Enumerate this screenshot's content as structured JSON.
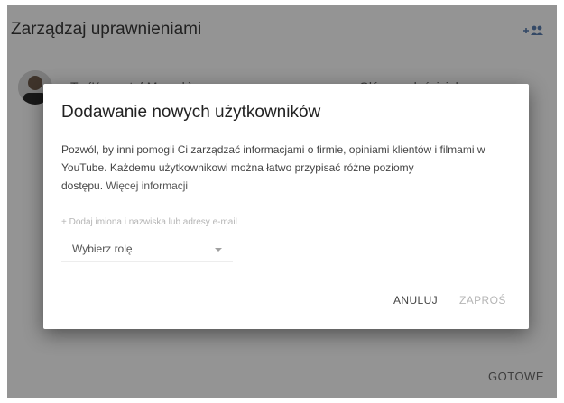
{
  "background": {
    "title": "Zarządzaj uprawnieniami",
    "add_people_icon": "add-people-icon",
    "user": {
      "name": "Ty (Krzysztof Mrozek)",
      "role": "Główny właściciel"
    },
    "done_label": "GOTOWE"
  },
  "dialog": {
    "title": "Dodawanie nowych użytkowników",
    "description_line1": "Pozwól, by inni pomogli Ci zarządzać informacjami o firmie, opiniami klientów i filmami w",
    "description_line2": "YouTube. Każdemu użytkownikowi można łatwo przypisać różne poziomy",
    "description_line3": "dostępu.",
    "learn_more": "Więcej informacji",
    "email_placeholder": "+ Dodaj imiona i nazwiska lub adresy e-mail",
    "role_select": {
      "label": "Wybierz rolę",
      "icon": "caret-down-icon"
    },
    "cancel_label": "ANULUJ",
    "send_label": "ZAPROŚ"
  },
  "colors": {
    "overlay": "#6b6b6b",
    "dialog_bg": "#ffffff",
    "disabled_text": "#b5b5b5"
  }
}
